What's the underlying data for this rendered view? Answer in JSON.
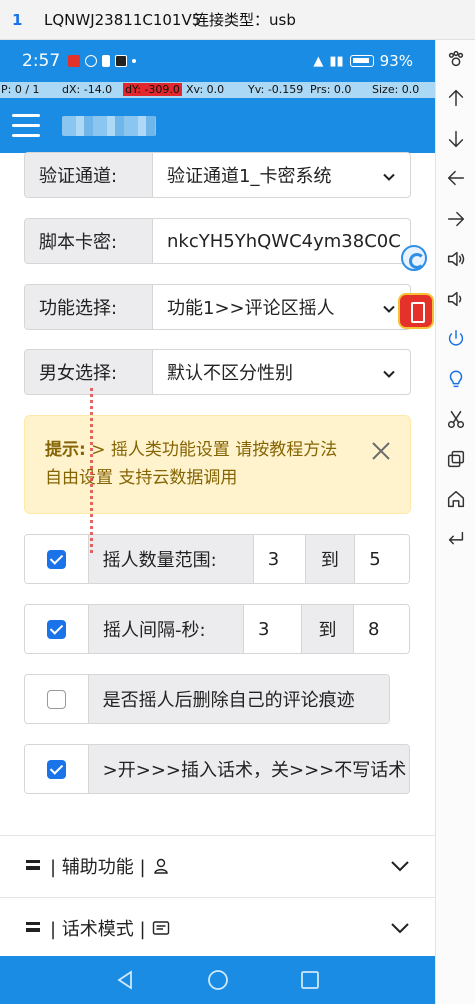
{
  "window": {
    "index": "1",
    "device": "LQNWJ23811C101V5",
    "connection": "连接类型：usb"
  },
  "status": {
    "time": "2:57",
    "battery": "93%"
  },
  "pointer": {
    "p": "P: 0 / 1",
    "dx": "dX: -14.0",
    "dy": "dY: -309.0",
    "xv": "Xv: 0.0",
    "yv": "Yv: -0.159",
    "prs": "Prs: 0.0",
    "size": "Size: 0.0"
  },
  "form": {
    "channel": {
      "label": "验证通道:",
      "value": "验证通道1_卡密系统"
    },
    "card": {
      "label": "脚本卡密:",
      "value": "nkcYH5YhQWC4ym38C0C"
    },
    "feature": {
      "label": "功能选择:",
      "value": "功能1>>评论区摇人"
    },
    "gender": {
      "label": "男女选择:",
      "value": "默认不区分性别"
    }
  },
  "alert": {
    "prefix": "提示:",
    "text": " > 摇人类功能设置 请按教程方法自由设置 支持云数据调用"
  },
  "checks": {
    "range": {
      "checked": true,
      "label": "摇人数量范围:",
      "from": "3",
      "to_label": "到",
      "to": "5"
    },
    "interval": {
      "checked": true,
      "label": "摇人间隔-秒:",
      "from": "3",
      "to_label": "到",
      "to": "8"
    },
    "delete": {
      "checked": false,
      "label": "是否摇人后删除自己的评论痕迹"
    },
    "speech": {
      "checked": true,
      "label": ">开>>>插入话术，关>>>不写话术"
    }
  },
  "sections": [
    {
      "title": "| 辅助功能 |",
      "icon": "user-icon"
    },
    {
      "title": "| 话术模式 |",
      "icon": "card-icon"
    }
  ],
  "colors": {
    "primary": "#1b8ce3",
    "checkbox": "#1a73e8",
    "alert_bg": "#fff3cd",
    "alert_text": "#856404"
  }
}
